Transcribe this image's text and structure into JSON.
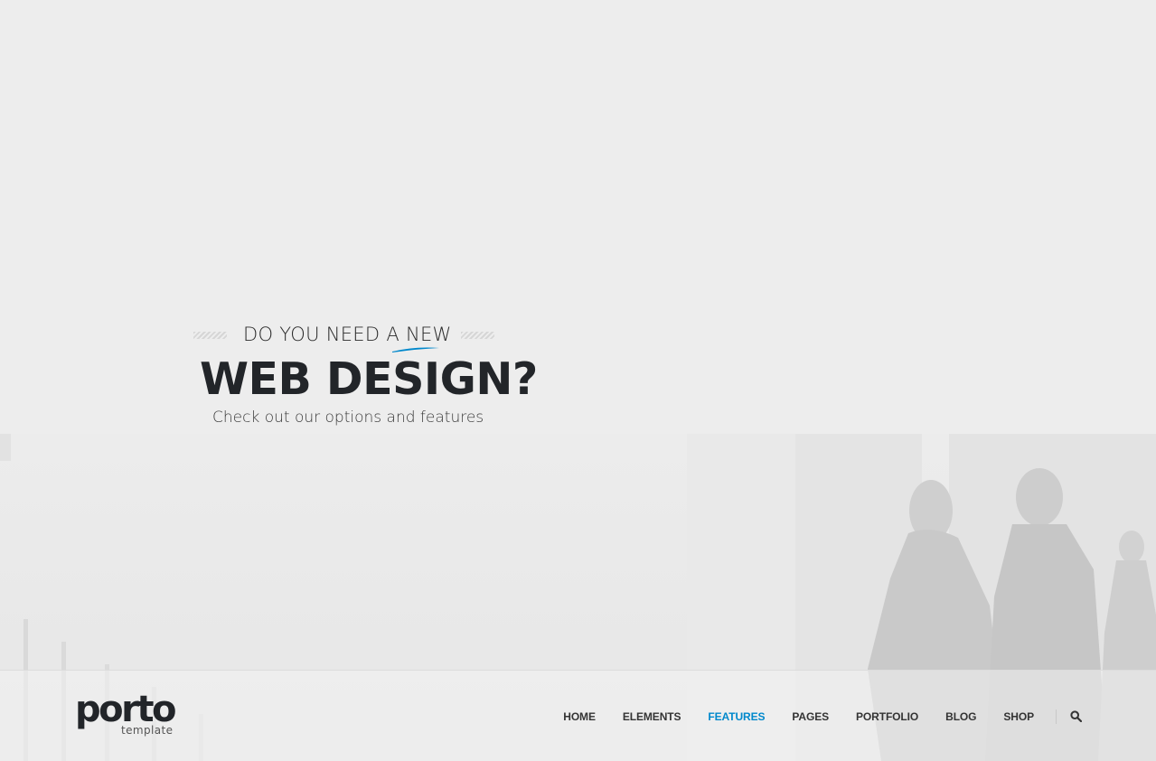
{
  "hero": {
    "kicker": "DO YOU NEED A NEW",
    "headline": "WEB DESIGN?",
    "subline": "Check out our options and features"
  },
  "logo": {
    "wordmark": "porto",
    "tagline": "template"
  },
  "nav": {
    "items": [
      {
        "label": "HOME"
      },
      {
        "label": "ELEMENTS"
      },
      {
        "label": "FEATURES",
        "active": true
      },
      {
        "label": "PAGES"
      },
      {
        "label": "PORTFOLIO"
      },
      {
        "label": "BLOG"
      },
      {
        "label": "SHOP"
      }
    ],
    "search_icon": "search-icon"
  },
  "colors": {
    "accent": "#0088cc",
    "text_dark": "#222529",
    "background": "#ededed"
  }
}
